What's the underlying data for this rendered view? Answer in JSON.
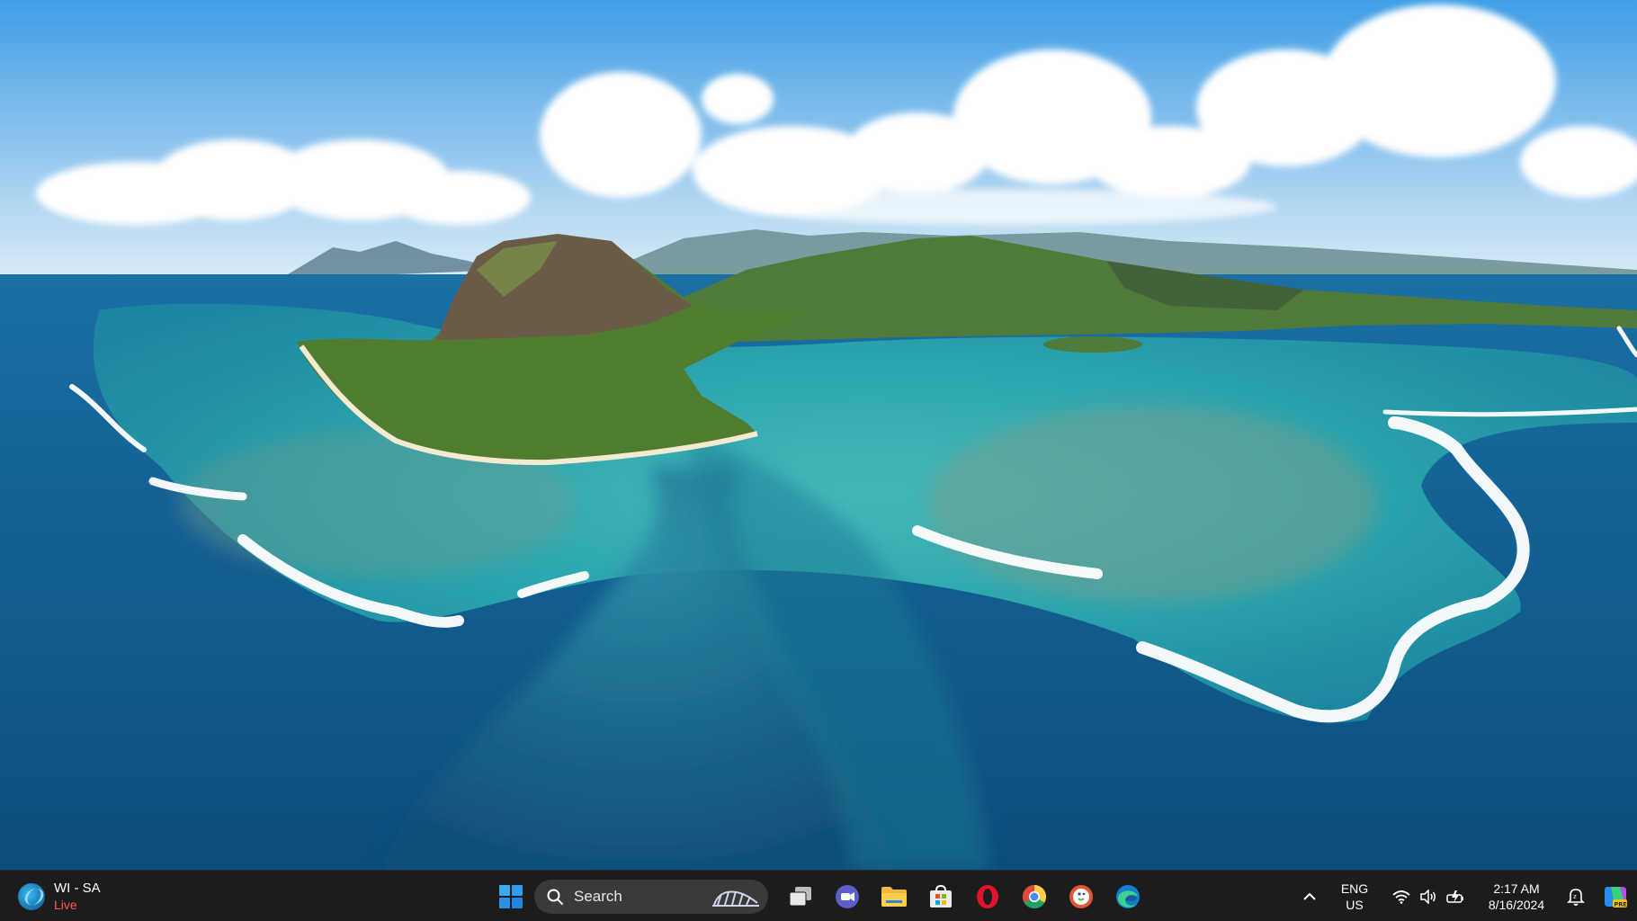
{
  "wallpaper": {
    "description_icon": "landscape-photo"
  },
  "taskbar": {
    "widget": {
      "title": "WI - SA",
      "status": "Live"
    },
    "search": {
      "label": "Search"
    },
    "pinned": [
      {
        "name": "task-view",
        "icon": "task-view-icon"
      },
      {
        "name": "meet",
        "icon": "video-chat-icon"
      },
      {
        "name": "file-explorer",
        "icon": "folder-icon"
      },
      {
        "name": "microsoft-store",
        "icon": "store-icon"
      },
      {
        "name": "opera",
        "icon": "opera-icon"
      },
      {
        "name": "chrome",
        "icon": "chrome-icon"
      },
      {
        "name": "duckduckgo",
        "icon": "duckduckgo-icon"
      },
      {
        "name": "edge",
        "icon": "edge-icon"
      }
    ],
    "tray": {
      "lang_line1": "ENG",
      "lang_line2": "US",
      "time": "2:17 AM",
      "date": "8/16/2024"
    }
  },
  "colors": {
    "taskbar_bg": "#1c1c1c",
    "search_bg": "#3a3a3a",
    "live_red": "#ff5a4f",
    "windows_blue": "#1d9bf0"
  }
}
